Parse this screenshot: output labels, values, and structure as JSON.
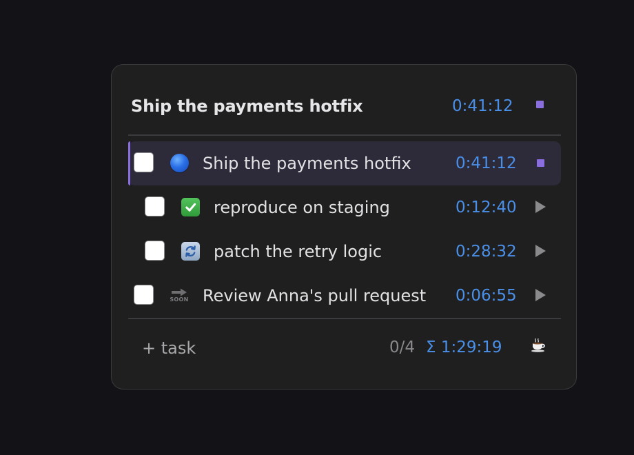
{
  "header": {
    "title": "Ship the payments hotfix",
    "time": "0:41:12",
    "stop_icon": "stop-square-icon"
  },
  "tasks": [
    {
      "label": "Ship the payments hotfix",
      "time": "0:41:12",
      "status_icon": "blue-circle-icon",
      "action_icon": "stop-square-icon",
      "active": true,
      "indent": 0
    },
    {
      "label": "reproduce on staging",
      "time": "0:12:40",
      "status_icon": "check-mark-button-icon",
      "action_icon": "play-icon",
      "active": false,
      "indent": 1
    },
    {
      "label": "patch the retry logic",
      "time": "0:28:32",
      "status_icon": "repeat-arrows-icon",
      "action_icon": "play-icon",
      "active": false,
      "indent": 1
    },
    {
      "label": "Review Anna's pull request",
      "time": "0:06:55",
      "status_icon": "soon-arrow-icon",
      "status_icon_text": "SOON",
      "action_icon": "play-icon",
      "active": false,
      "indent": 0
    }
  ],
  "footer": {
    "add_task_label": "+ task",
    "progress": "0/4",
    "total": "Σ 1:29:19",
    "break_icon": "coffee-cup-icon"
  },
  "colors": {
    "accent": "#8a6ee0",
    "time": "#4a8fe8",
    "panel": "#1f1f20",
    "background": "#131317"
  }
}
